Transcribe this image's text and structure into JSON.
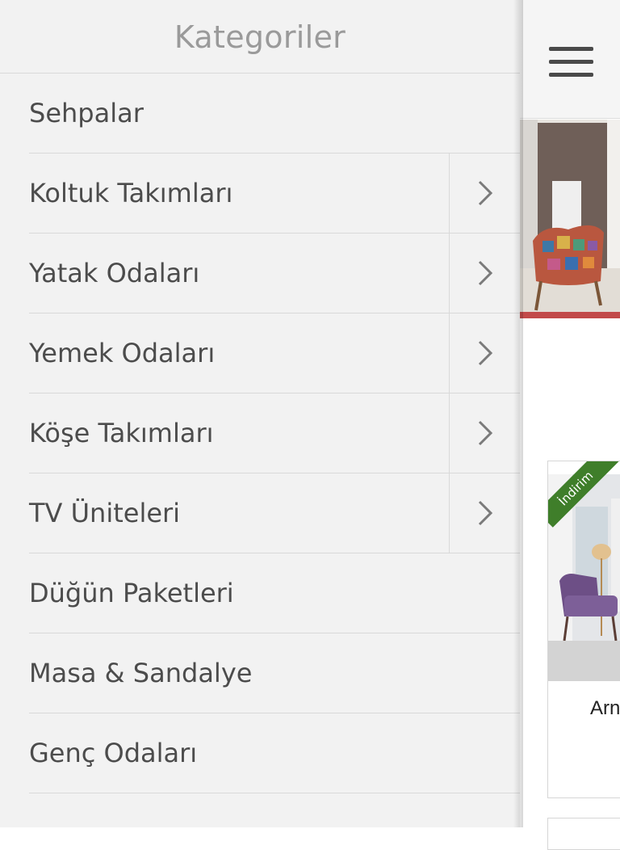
{
  "drawer": {
    "title": "Kategoriler",
    "items": [
      {
        "label": "Sehpalar",
        "has_submenu": false
      },
      {
        "label": "Koltuk Takımları",
        "has_submenu": true
      },
      {
        "label": "Yatak Odaları",
        "has_submenu": true
      },
      {
        "label": "Yemek Odaları",
        "has_submenu": true
      },
      {
        "label": "Köşe Takımları",
        "has_submenu": true
      },
      {
        "label": "TV Üniteleri",
        "has_submenu": true
      },
      {
        "label": "Düğün Paketleri",
        "has_submenu": false
      },
      {
        "label": "Masa & Sandalye",
        "has_submenu": false
      },
      {
        "label": "Genç Odaları",
        "has_submenu": false
      }
    ]
  },
  "page": {
    "product": {
      "badge": "İndirim",
      "name_visible": "Arn"
    }
  },
  "colors": {
    "drawer_bg": "#f2f2f2",
    "divider": "#d9d9d9",
    "badge_green": "#3f7e2a",
    "text": "#4c4c4c",
    "title": "#9a9a9a"
  },
  "icons": {
    "expand": "chevron-right-icon",
    "menu": "hamburger-menu-icon"
  }
}
